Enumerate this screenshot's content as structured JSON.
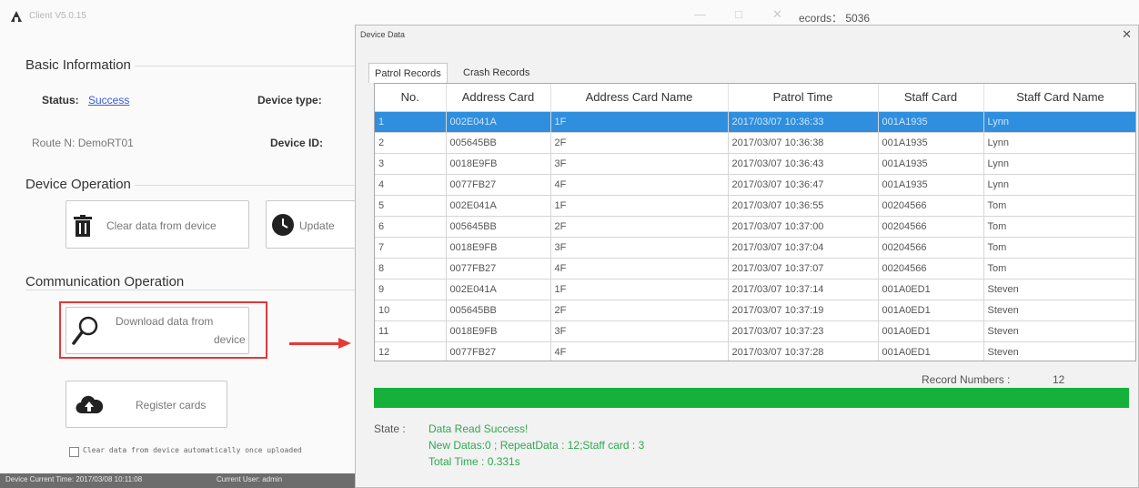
{
  "app": {
    "title": "Client V5.0.15",
    "records_label": "ecords： 5036",
    "minimize_glyph": "—",
    "maximize_glyph": "□",
    "close_glyph": "✕"
  },
  "basic_info": {
    "title": "Basic Information",
    "status_label": "Status:",
    "status_value": "Success",
    "device_type_label": "Device type:",
    "route_label": "Route N: DemoRT01",
    "device_id_label": "Device ID:"
  },
  "device_operation": {
    "title": "Device Operation",
    "clear_button": "Clear data from device",
    "update_button": "Update"
  },
  "communication": {
    "title": "Communication Operation",
    "download_line1": "Download data from",
    "download_line2": "device",
    "register_button": "Register cards",
    "auto_clear_label": "Clear data from device automatically once uploaded"
  },
  "statusbar": {
    "time": "Device Current Time: 2017/03/08 10:11:08",
    "user": "Current User: admin"
  },
  "dialog": {
    "title": "Device Data",
    "close_glyph": "✕",
    "tabs": [
      "Patrol Records",
      "Crash Records"
    ],
    "columns": [
      "No.",
      "Address Card",
      "Address Card Name",
      "Patrol Time",
      "Staff Card",
      "Staff Card Name"
    ],
    "rows": [
      [
        "1",
        "002E041A",
        "1F",
        "2017/03/07 10:36:33",
        "001A1935",
        "Lynn"
      ],
      [
        "2",
        "005645BB",
        "2F",
        "2017/03/07 10:36:38",
        "001A1935",
        "Lynn"
      ],
      [
        "3",
        "0018E9FB",
        "3F",
        "2017/03/07 10:36:43",
        "001A1935",
        "Lynn"
      ],
      [
        "4",
        "0077FB27",
        "4F",
        "2017/03/07 10:36:47",
        "001A1935",
        "Lynn"
      ],
      [
        "5",
        "002E041A",
        "1F",
        "2017/03/07 10:36:55",
        "00204566",
        "Tom"
      ],
      [
        "6",
        "005645BB",
        "2F",
        "2017/03/07 10:37:00",
        "00204566",
        "Tom"
      ],
      [
        "7",
        "0018E9FB",
        "3F",
        "2017/03/07 10:37:04",
        "00204566",
        "Tom"
      ],
      [
        "8",
        "0077FB27",
        "4F",
        "2017/03/07 10:37:07",
        "00204566",
        "Tom"
      ],
      [
        "9",
        "002E041A",
        "1F",
        "2017/03/07 10:37:14",
        "001A0ED1",
        "Steven"
      ],
      [
        "10",
        "005645BB",
        "2F",
        "2017/03/07 10:37:19",
        "001A0ED1",
        "Steven"
      ],
      [
        "11",
        "0018E9FB",
        "3F",
        "2017/03/07 10:37:23",
        "001A0ED1",
        "Steven"
      ],
      [
        "12",
        "0077FB27",
        "4F",
        "2017/03/07 10:37:28",
        "001A0ED1",
        "Steven"
      ]
    ],
    "selected_row": 0,
    "record_numbers_label": "Record Numbers :",
    "record_numbers_value": "12",
    "progress_fraction": 1.0,
    "state_label": "State :",
    "state_lines": [
      "Data Read Success!",
      "New Datas:0 ; RepeatData : 12;Staff card : 3",
      "Total Time : 0.331s"
    ]
  },
  "colors": {
    "selection": "#2f8fde",
    "progress": "#16b13a",
    "state_text": "#2fa84f",
    "highlight": "#e03a3a"
  }
}
